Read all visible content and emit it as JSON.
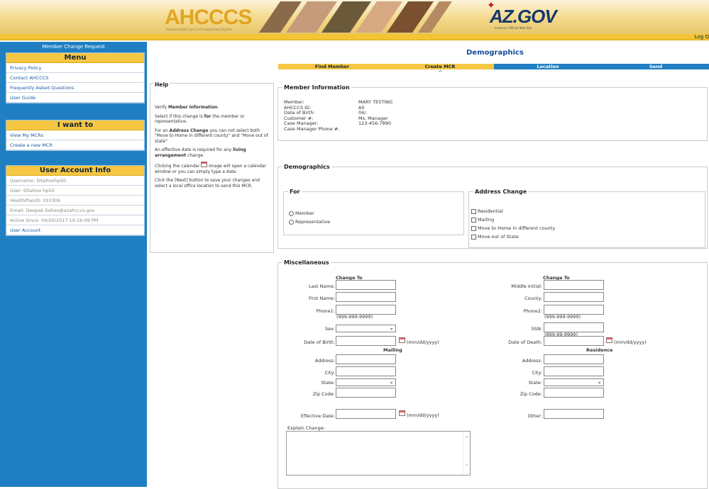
{
  "banner": {
    "ahcccs_logo": "AHCCCS",
    "ahcccs_sub": "Arizona Health Care Cost Containment System",
    "az_logo": "AZ.GOV",
    "az_sub": "Arizona's Official Web Site",
    "logout": "Log O"
  },
  "sidebar": {
    "title": "Member Change Request",
    "menu": {
      "heading": "Menu",
      "items": [
        "Privacy Policy",
        "Contact AHCCCS",
        "Frequently Asked Questions",
        "User Guide"
      ]
    },
    "iwant": {
      "heading": "I want to",
      "items": [
        "View My MCRs",
        "Create a new MCR"
      ]
    },
    "account": {
      "heading": "User Account Info",
      "items": [
        "Username: DSahoohp50",
        "User: DSahoo hp50",
        "HealthPlanID: 010306",
        "Email: Deepak.Sahoo@azahcccs.gov",
        "Active Since: 04/20/2017 10:16:09 PM"
      ],
      "link": "User Account"
    }
  },
  "page": {
    "title": "Demographics",
    "steps": [
      "Find Member",
      "Create MCR",
      "Location",
      "Send"
    ],
    "caret": "^"
  },
  "help": {
    "title": "Help",
    "p1a": "Verify ",
    "p1b": "Member Information",
    ".": ".",
    "p2a": "Select if this change is ",
    "p2b": "for",
    " p2c": "",
    "p2c": " the member or representative.",
    "p3a": "For an ",
    "p3b": "Address Change",
    "p3c": " you can not select both \"Move to Home in different county\" and \"Move out of state\"",
    "p4a": "An effective date is required for any ",
    "p4b": "living arrangement",
    "p4c": " change.",
    "p5a": "Clicking the calendar ",
    "p5b": " image will open a calendar window or you can simply type a date.",
    "p6": "Click the [Next] button to save your changes and select a local office location to send this MCR."
  },
  "member": {
    "legend": "Member Information",
    "labels": [
      "Member:",
      "AHCCCS ID:",
      "Date of Birth:",
      "Customer #:",
      "Case Manager:",
      "Case Manager Phone #:"
    ],
    "values": [
      "MARY TESTING",
      "A0",
      "04/.",
      "",
      "Ms. Manager",
      "123-456-7890"
    ]
  },
  "demo": {
    "legend": "Demographics",
    "for_legend": "For",
    "for_options": [
      "Member",
      "Representative"
    ],
    "addr_legend": "Address Change",
    "addr_options": [
      "Residential",
      "Mailing",
      "Move to Home in different county",
      "Move out of State"
    ]
  },
  "misc": {
    "legend": "Miscellaneous",
    "change_to": "Change To",
    "left_labels": [
      "Last Name:",
      "First Name:",
      "Phone1:",
      "Sex:",
      "Date of Birth:"
    ],
    "right_labels": [
      "Middle Initial:",
      "County:",
      "Phone2:",
      "SSN:",
      "Date of Death:"
    ],
    "phone_hint": "(999-999-9999)",
    "ssn_hint": "(999-99-9999)",
    "date_hint": "(mm/dd/yyyy)",
    "mailing": "Mailing",
    "residence": "Residence",
    "addr_labels": [
      "Address:",
      "City:",
      "State:",
      "Zip Code:"
    ],
    "effective": "Effective Date:",
    "other": "Other:",
    "explain": "Explain Change:"
  },
  "colors": {
    "blue": "#1f7fc2",
    "gold": "#f5c743"
  }
}
